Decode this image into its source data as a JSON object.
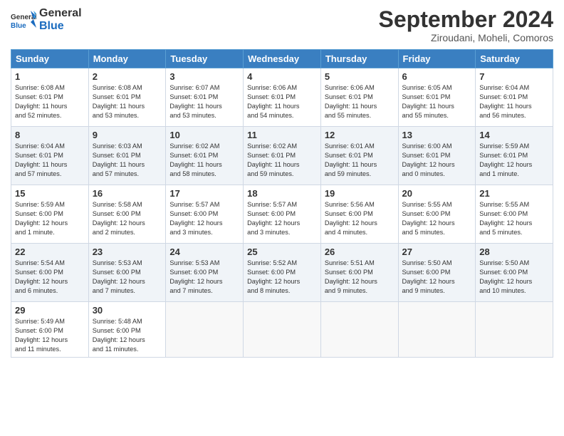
{
  "header": {
    "logo_general": "General",
    "logo_blue": "Blue",
    "month_title": "September 2024",
    "location": "Ziroudani, Moheli, Comoros"
  },
  "weekdays": [
    "Sunday",
    "Monday",
    "Tuesday",
    "Wednesday",
    "Thursday",
    "Friday",
    "Saturday"
  ],
  "weeks": [
    [
      {
        "day": "1",
        "info": "Sunrise: 6:08 AM\nSunset: 6:01 PM\nDaylight: 11 hours\nand 52 minutes."
      },
      {
        "day": "2",
        "info": "Sunrise: 6:08 AM\nSunset: 6:01 PM\nDaylight: 11 hours\nand 53 minutes."
      },
      {
        "day": "3",
        "info": "Sunrise: 6:07 AM\nSunset: 6:01 PM\nDaylight: 11 hours\nand 53 minutes."
      },
      {
        "day": "4",
        "info": "Sunrise: 6:06 AM\nSunset: 6:01 PM\nDaylight: 11 hours\nand 54 minutes."
      },
      {
        "day": "5",
        "info": "Sunrise: 6:06 AM\nSunset: 6:01 PM\nDaylight: 11 hours\nand 55 minutes."
      },
      {
        "day": "6",
        "info": "Sunrise: 6:05 AM\nSunset: 6:01 PM\nDaylight: 11 hours\nand 55 minutes."
      },
      {
        "day": "7",
        "info": "Sunrise: 6:04 AM\nSunset: 6:01 PM\nDaylight: 11 hours\nand 56 minutes."
      }
    ],
    [
      {
        "day": "8",
        "info": "Sunrise: 6:04 AM\nSunset: 6:01 PM\nDaylight: 11 hours\nand 57 minutes."
      },
      {
        "day": "9",
        "info": "Sunrise: 6:03 AM\nSunset: 6:01 PM\nDaylight: 11 hours\nand 57 minutes."
      },
      {
        "day": "10",
        "info": "Sunrise: 6:02 AM\nSunset: 6:01 PM\nDaylight: 11 hours\nand 58 minutes."
      },
      {
        "day": "11",
        "info": "Sunrise: 6:02 AM\nSunset: 6:01 PM\nDaylight: 11 hours\nand 59 minutes."
      },
      {
        "day": "12",
        "info": "Sunrise: 6:01 AM\nSunset: 6:01 PM\nDaylight: 11 hours\nand 59 minutes."
      },
      {
        "day": "13",
        "info": "Sunrise: 6:00 AM\nSunset: 6:01 PM\nDaylight: 12 hours\nand 0 minutes."
      },
      {
        "day": "14",
        "info": "Sunrise: 5:59 AM\nSunset: 6:01 PM\nDaylight: 12 hours\nand 1 minute."
      }
    ],
    [
      {
        "day": "15",
        "info": "Sunrise: 5:59 AM\nSunset: 6:00 PM\nDaylight: 12 hours\nand 1 minute."
      },
      {
        "day": "16",
        "info": "Sunrise: 5:58 AM\nSunset: 6:00 PM\nDaylight: 12 hours\nand 2 minutes."
      },
      {
        "day": "17",
        "info": "Sunrise: 5:57 AM\nSunset: 6:00 PM\nDaylight: 12 hours\nand 3 minutes."
      },
      {
        "day": "18",
        "info": "Sunrise: 5:57 AM\nSunset: 6:00 PM\nDaylight: 12 hours\nand 3 minutes."
      },
      {
        "day": "19",
        "info": "Sunrise: 5:56 AM\nSunset: 6:00 PM\nDaylight: 12 hours\nand 4 minutes."
      },
      {
        "day": "20",
        "info": "Sunrise: 5:55 AM\nSunset: 6:00 PM\nDaylight: 12 hours\nand 5 minutes."
      },
      {
        "day": "21",
        "info": "Sunrise: 5:55 AM\nSunset: 6:00 PM\nDaylight: 12 hours\nand 5 minutes."
      }
    ],
    [
      {
        "day": "22",
        "info": "Sunrise: 5:54 AM\nSunset: 6:00 PM\nDaylight: 12 hours\nand 6 minutes."
      },
      {
        "day": "23",
        "info": "Sunrise: 5:53 AM\nSunset: 6:00 PM\nDaylight: 12 hours\nand 7 minutes."
      },
      {
        "day": "24",
        "info": "Sunrise: 5:53 AM\nSunset: 6:00 PM\nDaylight: 12 hours\nand 7 minutes."
      },
      {
        "day": "25",
        "info": "Sunrise: 5:52 AM\nSunset: 6:00 PM\nDaylight: 12 hours\nand 8 minutes."
      },
      {
        "day": "26",
        "info": "Sunrise: 5:51 AM\nSunset: 6:00 PM\nDaylight: 12 hours\nand 9 minutes."
      },
      {
        "day": "27",
        "info": "Sunrise: 5:50 AM\nSunset: 6:00 PM\nDaylight: 12 hours\nand 9 minutes."
      },
      {
        "day": "28",
        "info": "Sunrise: 5:50 AM\nSunset: 6:00 PM\nDaylight: 12 hours\nand 10 minutes."
      }
    ],
    [
      {
        "day": "29",
        "info": "Sunrise: 5:49 AM\nSunset: 6:00 PM\nDaylight: 12 hours\nand 11 minutes."
      },
      {
        "day": "30",
        "info": "Sunrise: 5:48 AM\nSunset: 6:00 PM\nDaylight: 12 hours\nand 11 minutes."
      },
      {
        "day": "",
        "info": ""
      },
      {
        "day": "",
        "info": ""
      },
      {
        "day": "",
        "info": ""
      },
      {
        "day": "",
        "info": ""
      },
      {
        "day": "",
        "info": ""
      }
    ]
  ]
}
